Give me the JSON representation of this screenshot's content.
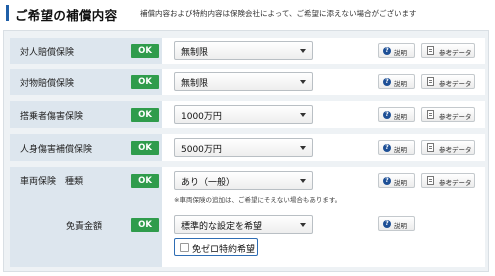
{
  "header": {
    "title": "ご希望の補償内容",
    "note": "補償内容および特約内容は保険会社によって、ご希望に添えない場合がございます"
  },
  "buttons": {
    "explain": "説明",
    "reference": "参考データ",
    "question_mark": "?"
  },
  "status_ok": "OK",
  "rows": [
    {
      "label": "対人賠償保険",
      "value": "無制限"
    },
    {
      "label": "対物賠償保険",
      "value": "無制限"
    },
    {
      "label": "搭乗者傷害保険",
      "value": "1000万円"
    },
    {
      "label": "人身傷害補償保険",
      "value": "5000万円"
    },
    {
      "label": "車両保険　種類",
      "value": "あり（一般）",
      "remark": "※車両保険の追加は、ご希望にそえない場合もあります。"
    }
  ],
  "deductible": {
    "label": "免責金額",
    "value": "標準的な設定を希望",
    "option_label": "免ゼロ特約希望",
    "option_checked": false
  },
  "colors": {
    "ok_green": "#2f9c4c",
    "accent_blue": "#1f5fa8"
  }
}
